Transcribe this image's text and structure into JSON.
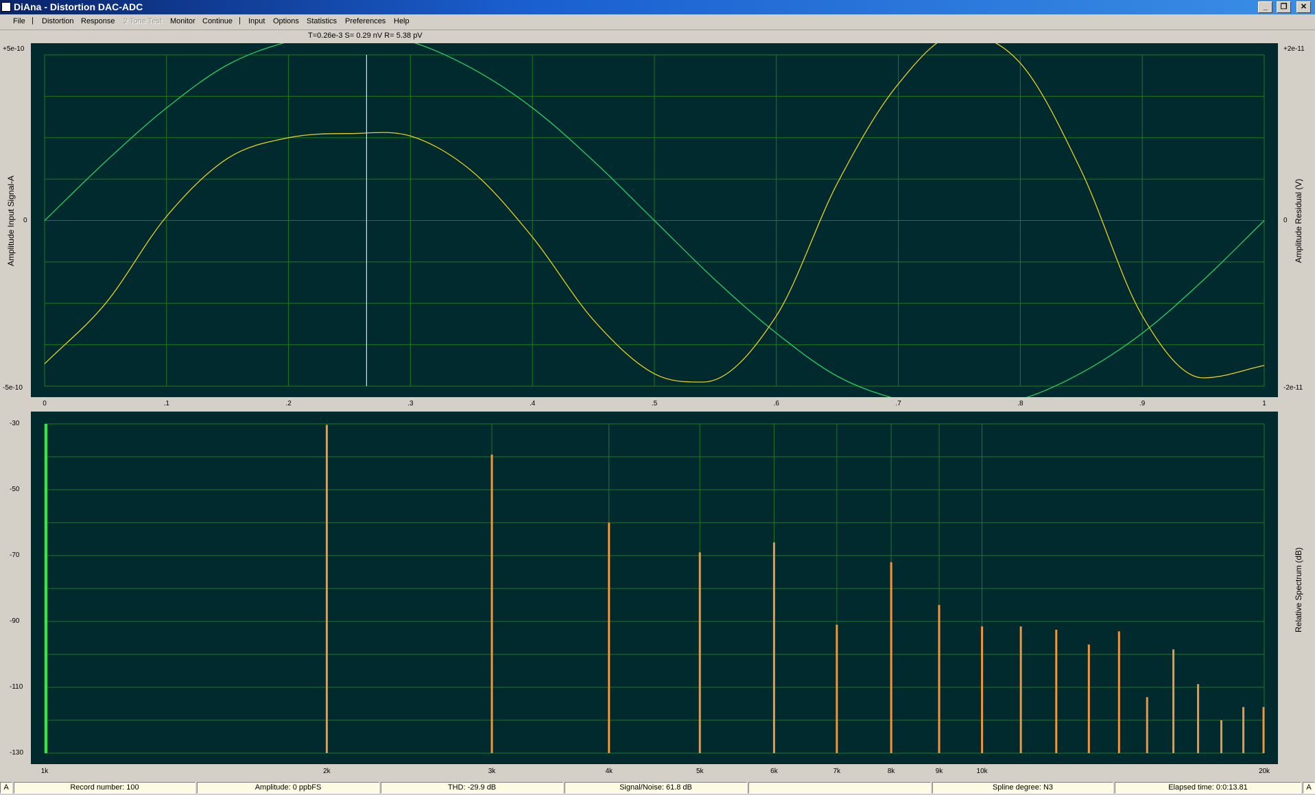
{
  "window": {
    "title": "DiAna - Distortion DAC-ADC",
    "min_btn": "_",
    "max_btn": "❐",
    "close_btn": "✕"
  },
  "menu": [
    {
      "label": "File",
      "enabled": true
    },
    {
      "label": "|",
      "separator": true
    },
    {
      "label": "Distortion",
      "enabled": true
    },
    {
      "label": "Response",
      "enabled": true
    },
    {
      "label": "2 Tone Test",
      "enabled": false
    },
    {
      "label": "Monitor",
      "enabled": true
    },
    {
      "label": "Continue",
      "enabled": true
    },
    {
      "label": "|",
      "separator": true
    },
    {
      "label": "Input",
      "enabled": true
    },
    {
      "label": "Options",
      "enabled": true
    },
    {
      "label": "Statistics",
      "enabled": true
    },
    {
      "label": "Preferences",
      "enabled": true
    },
    {
      "label": "Help",
      "enabled": true
    }
  ],
  "cursor_readout": "T=0.26e-3 S= 0.29 nV R= 5.38 pV",
  "colors": {
    "plot_bg": "#012a2e",
    "grid": "#1f7a1f",
    "signal": "#27d060",
    "residual": "#e8d21a",
    "cursor": "#c8e8f0",
    "fundamental": "#2ee84a",
    "harmonics": "#f0963c"
  },
  "chart_data": [
    {
      "type": "line",
      "title": "",
      "xlabel": "",
      "ylabel_left": "Amplitude Input Signal-A",
      "ylabel_right": "Amplitude Residual (V)",
      "left_axis_ticks": [
        "+5e-10",
        "0",
        "-5e-10"
      ],
      "right_axis_ticks": [
        "+2e-11",
        "0",
        "-2e-11"
      ],
      "x_ticks": [
        "0",
        ".1",
        ".2",
        ".3",
        ".4",
        ".5",
        ".6",
        ".7",
        ".8",
        ".9",
        "1"
      ],
      "xlim": [
        0,
        1
      ],
      "ylim_left": [
        -5e-10,
        5e-10
      ],
      "ylim_right": [
        -2e-11,
        2e-11
      ],
      "cursor_x": 0.264,
      "grid": true,
      "series": [
        {
          "color_key": "signal",
          "axis": "left",
          "x": [
            0,
            0.05,
            0.1,
            0.15,
            0.2,
            0.25,
            0.3,
            0.35,
            0.4,
            0.45,
            0.5,
            0.55,
            0.6,
            0.65,
            0.7,
            0.75,
            0.8,
            0.85,
            0.9,
            0.95,
            1.0
          ],
          "y": [
            0,
            1.78e-10,
            3.4e-10,
            4.7e-10,
            5.4e-10,
            5.7e-10,
            5.4e-10,
            4.6e-10,
            3.4e-10,
            1.8e-10,
            0,
            -1.8e-10,
            -3.4e-10,
            -4.7e-10,
            -5.4e-10,
            -5.7e-10,
            -5.4e-10,
            -4.6e-10,
            -3.4e-10,
            -1.8e-10,
            0
          ]
        },
        {
          "color_key": "residual",
          "axis": "right",
          "x": [
            0,
            0.05,
            0.1,
            0.15,
            0.2,
            0.25,
            0.3,
            0.35,
            0.4,
            0.45,
            0.5,
            0.54,
            0.6,
            0.65,
            0.7,
            0.75,
            0.8,
            0.85,
            0.9,
            0.95,
            1.0
          ],
          "y": [
            -1.73e-11,
            -1e-11,
            5e-13,
            7.5e-12,
            1e-11,
            1.05e-11,
            1.02e-11,
            6e-12,
            -2e-12,
            -1.2e-11,
            -1.85e-11,
            -1.95e-11,
            -1.15e-11,
            4.5e-12,
            1.65e-11,
            2.25e-11,
            1.9e-11,
            6e-12,
            -1.15e-11,
            -1.9e-11,
            -1.75e-11
          ]
        }
      ]
    },
    {
      "type": "bar",
      "title": "",
      "ylabel_right": "Relative Spectrum (dB)",
      "y_ticks": [
        "-30",
        "-50",
        "-70",
        "-90",
        "-110",
        "-130"
      ],
      "ylim": [
        -130,
        -30
      ],
      "x_scale": "log",
      "xlim": [
        1000,
        20000
      ],
      "x_tick_labels": [
        "1k",
        "2k",
        "3k",
        "4k",
        "5k",
        "6k",
        "7k",
        "8k",
        "9k",
        "10k",
        "20k"
      ],
      "x_tick_values": [
        1000,
        2000,
        3000,
        4000,
        5000,
        6000,
        7000,
        8000,
        9000,
        10000,
        20000
      ],
      "grid": true,
      "fundamental": {
        "freq": 1000,
        "db": -30
      },
      "harmonics": [
        {
          "freq": 2000,
          "db": -30.3
        },
        {
          "freq": 3000,
          "db": -39.3
        },
        {
          "freq": 4000,
          "db": -60
        },
        {
          "freq": 5000,
          "db": -69
        },
        {
          "freq": 6000,
          "db": -66
        },
        {
          "freq": 7000,
          "db": -91
        },
        {
          "freq": 8000,
          "db": -72
        },
        {
          "freq": 9000,
          "db": -85
        },
        {
          "freq": 10000,
          "db": -91.5
        },
        {
          "freq": 11000,
          "db": -91.5
        },
        {
          "freq": 12000,
          "db": -92.5
        },
        {
          "freq": 13000,
          "db": -97
        },
        {
          "freq": 14000,
          "db": -93
        },
        {
          "freq": 15000,
          "db": -113
        },
        {
          "freq": 16000,
          "db": -98.5
        },
        {
          "freq": 17000,
          "db": -109
        },
        {
          "freq": 18000,
          "db": -120
        },
        {
          "freq": 19000,
          "db": -116
        },
        {
          "freq": 20000,
          "db": -116
        }
      ]
    }
  ],
  "status": {
    "left_corner": "A",
    "record": "Record number: 100",
    "amplitude": "Amplitude: 0 ppbFS",
    "thd": "THD:  -29.9 dB",
    "snr": "Signal/Noise:   61.8 dB",
    "empty": "",
    "spline": "Spline degree: N3",
    "elapsed": "Elapsed time: 0:0:13.81",
    "right_corner": "A"
  }
}
